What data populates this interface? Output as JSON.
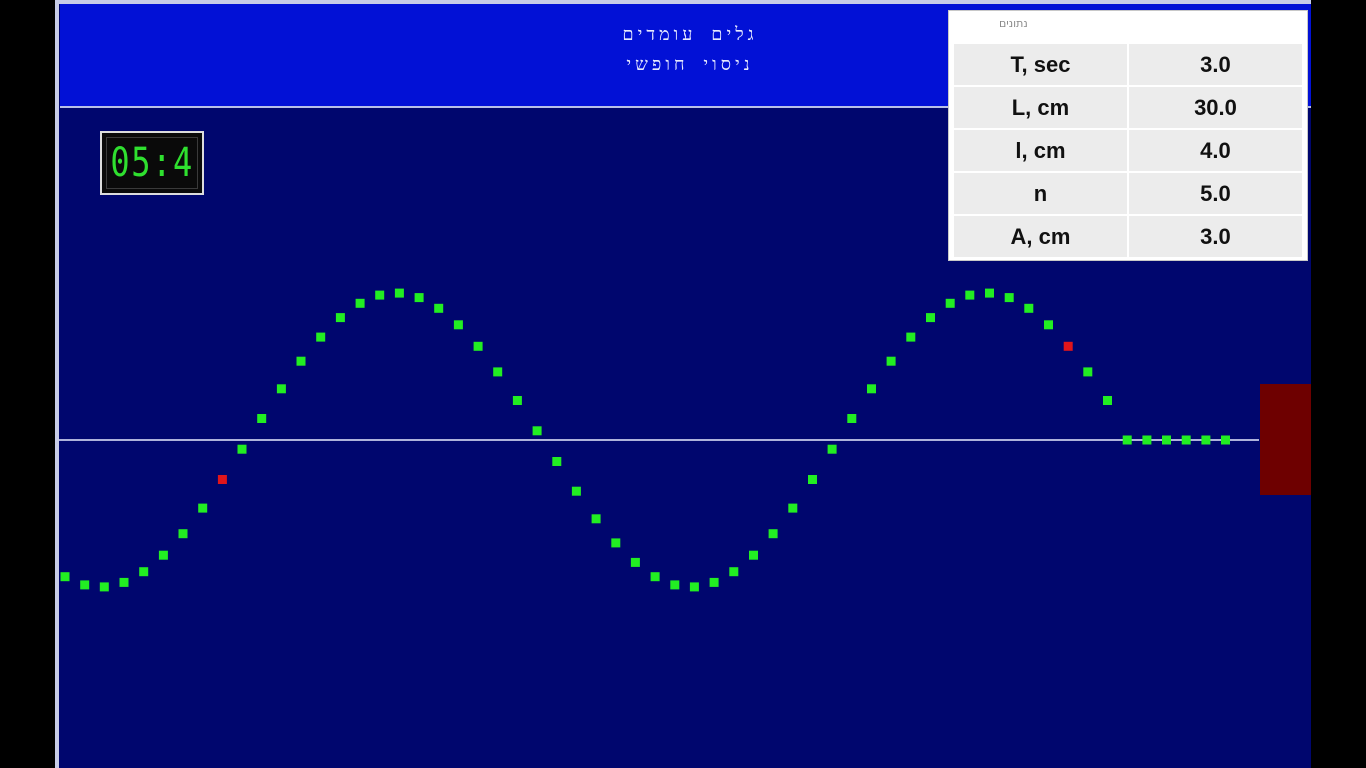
{
  "header": {
    "title": "גלים עומדים",
    "subtitle": "ניסוי חופשי"
  },
  "timer": {
    "display": "05:4"
  },
  "params": {
    "title": "נתונים",
    "rows": [
      {
        "name": "T, sec",
        "value": "3.0"
      },
      {
        "name": "L, cm",
        "value": "30.0"
      },
      {
        "name": "l, cm",
        "value": "4.0"
      },
      {
        "name": "n",
        "value": "5.0"
      },
      {
        "name": "A, cm",
        "value": "3.0"
      }
    ]
  },
  "colors": {
    "stage_bg": "#00066e",
    "header_bg": "#0211d6",
    "particle": "#22ee22",
    "marker": "#e0151b",
    "source_block": "#6e0000",
    "axis_line": "#e8ecff"
  },
  "wave": {
    "particle_count": 60,
    "wavelength_particles": 30,
    "amplitude_cm": 3.0,
    "marked_particles": [
      8,
      51
    ]
  }
}
